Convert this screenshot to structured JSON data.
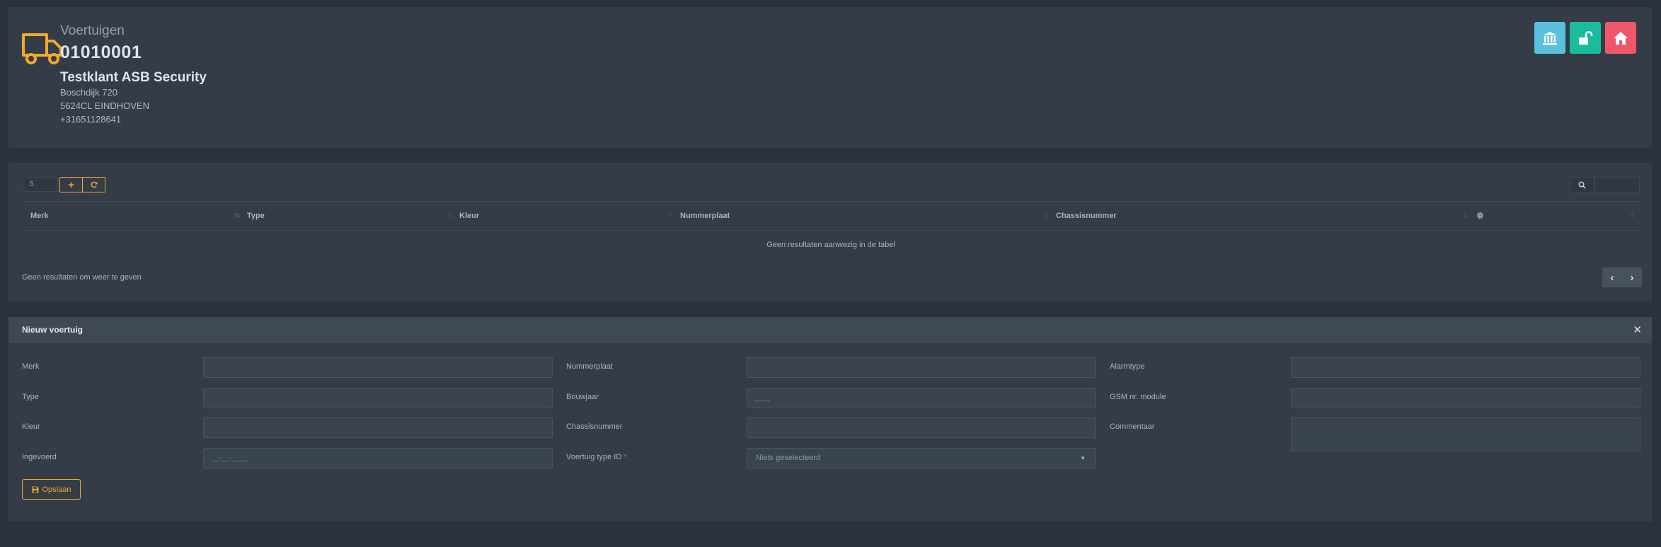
{
  "header": {
    "section_title": "Voertuigen",
    "code": "01010001",
    "client_name": "Testklant ASB Security",
    "address_line1": "Boschdijk 720",
    "address_line2": "5624CL EINDHOVEN",
    "phone": "+31651128641",
    "buttons": [
      {
        "icon": "bank-icon",
        "color": "#5bc0de"
      },
      {
        "icon": "unlock-icon",
        "color": "#1abc9c"
      },
      {
        "icon": "home-icon",
        "color": "#f0566a"
      }
    ]
  },
  "table": {
    "page_length": "5",
    "columns": [
      "Merk",
      "Type",
      "Kleur",
      "Nummerplaat",
      "Chassisnummer"
    ],
    "settings_icon": "gear-icon",
    "empty_message": "Geen resultaten aanwezig in de tabel",
    "info_text": "Geen resultaten om weer te geven"
  },
  "form": {
    "title": "Nieuw voertuig",
    "fields": {
      "merk": {
        "label": "Merk",
        "value": ""
      },
      "type": {
        "label": "Type",
        "value": ""
      },
      "kleur": {
        "label": "Kleur",
        "value": ""
      },
      "ingevoerd": {
        "label": "Ingevoerd",
        "placeholder": "__-__-____"
      },
      "nummerplaat": {
        "label": "Nummerplaat",
        "value": ""
      },
      "bouwjaar": {
        "label": "Bouwjaar",
        "placeholder": "____"
      },
      "chassisnummer": {
        "label": "Chassisnummer",
        "value": ""
      },
      "voertuig_type": {
        "label": "Voertuig type ID",
        "required_mark": "*",
        "selected": "Niets geselecteerd"
      },
      "alarmtype": {
        "label": "Alarmtype",
        "value": ""
      },
      "gsm": {
        "label": "GSM nr. module",
        "value": ""
      },
      "commentaar": {
        "label": "Commentaar",
        "value": ""
      }
    },
    "save_label": "Opslaan"
  },
  "colors": {
    "accent": "#f0a92b",
    "background": "#2b323b",
    "panel": "#343d47"
  }
}
